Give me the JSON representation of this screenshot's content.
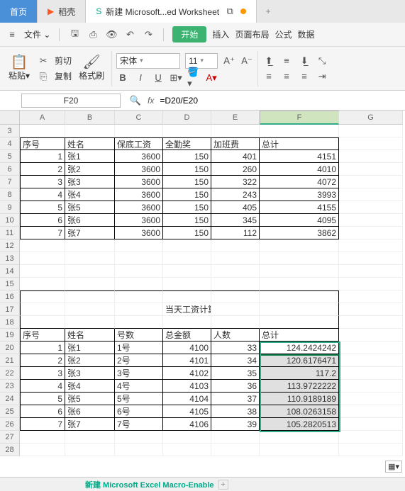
{
  "tabs": {
    "home": "首页",
    "dk": "稻壳",
    "doc": "新建 Microsoft...ed Worksheet"
  },
  "menu": {
    "file": "文件",
    "start": "开始",
    "insert": "插入",
    "layout": "页面布局",
    "formula": "公式",
    "data": "数据"
  },
  "tools": {
    "cut": "剪切",
    "copy": "复制",
    "paste": "粘贴",
    "painter": "格式刷",
    "font": "宋体",
    "size": "11"
  },
  "cellref": "F20",
  "formula": "=D20/E20",
  "cols": [
    "A",
    "B",
    "C",
    "D",
    "E",
    "F",
    "G"
  ],
  "t1_head": [
    "序号",
    "姓名",
    "保底工资",
    "全勤奖",
    "加班费",
    "总计"
  ],
  "t1": [
    [
      "1",
      "张1",
      "3600",
      "150",
      "401",
      "4151"
    ],
    [
      "2",
      "张2",
      "3600",
      "150",
      "260",
      "4010"
    ],
    [
      "3",
      "张3",
      "3600",
      "150",
      "322",
      "4072"
    ],
    [
      "4",
      "张4",
      "3600",
      "150",
      "243",
      "3993"
    ],
    [
      "5",
      "张5",
      "3600",
      "150",
      "405",
      "4155"
    ],
    [
      "6",
      "张6",
      "3600",
      "150",
      "345",
      "4095"
    ],
    [
      "7",
      "张7",
      "3600",
      "150",
      "112",
      "3862"
    ]
  ],
  "t2_title": "当天工资计算表",
  "t2_head": [
    "序号",
    "姓名",
    "号数",
    "总金额",
    "人数",
    "总计"
  ],
  "t2": [
    [
      "1",
      "张1",
      "1号",
      "4100",
      "33",
      "124.2424242"
    ],
    [
      "2",
      "张2",
      "2号",
      "4101",
      "34",
      "120.6176471"
    ],
    [
      "3",
      "张3",
      "3号",
      "4102",
      "35",
      "117.2"
    ],
    [
      "4",
      "张4",
      "4号",
      "4103",
      "36",
      "113.9722222"
    ],
    [
      "5",
      "张5",
      "5号",
      "4104",
      "37",
      "110.9189189"
    ],
    [
      "6",
      "张6",
      "6号",
      "4105",
      "38",
      "108.0263158"
    ],
    [
      "7",
      "张7",
      "7号",
      "4106",
      "39",
      "105.2820513"
    ]
  ],
  "sheettab": "新建 Microsoft Excel Macro-Enable",
  "autofill_icon": "▦▾"
}
